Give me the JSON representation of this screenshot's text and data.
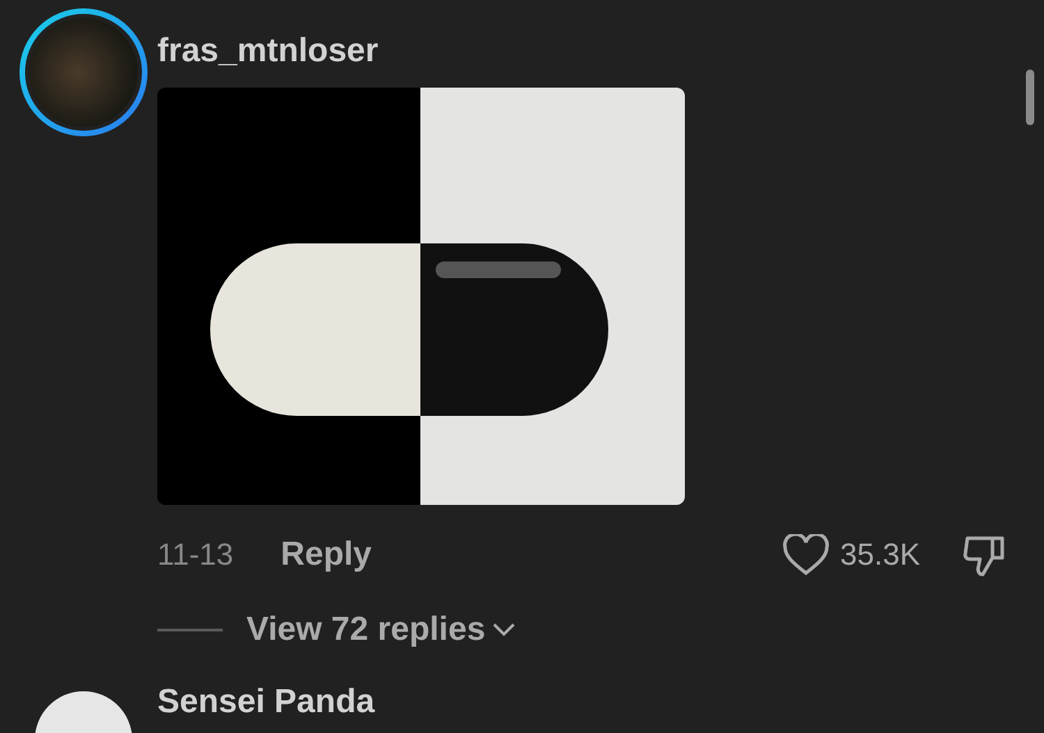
{
  "comment": {
    "username": "fras_mtnloser",
    "date": "11-13",
    "reply_label": "Reply",
    "likes": "35.3K",
    "view_replies": "View 72 replies"
  },
  "next_comment": {
    "username": "Sensei Panda"
  }
}
